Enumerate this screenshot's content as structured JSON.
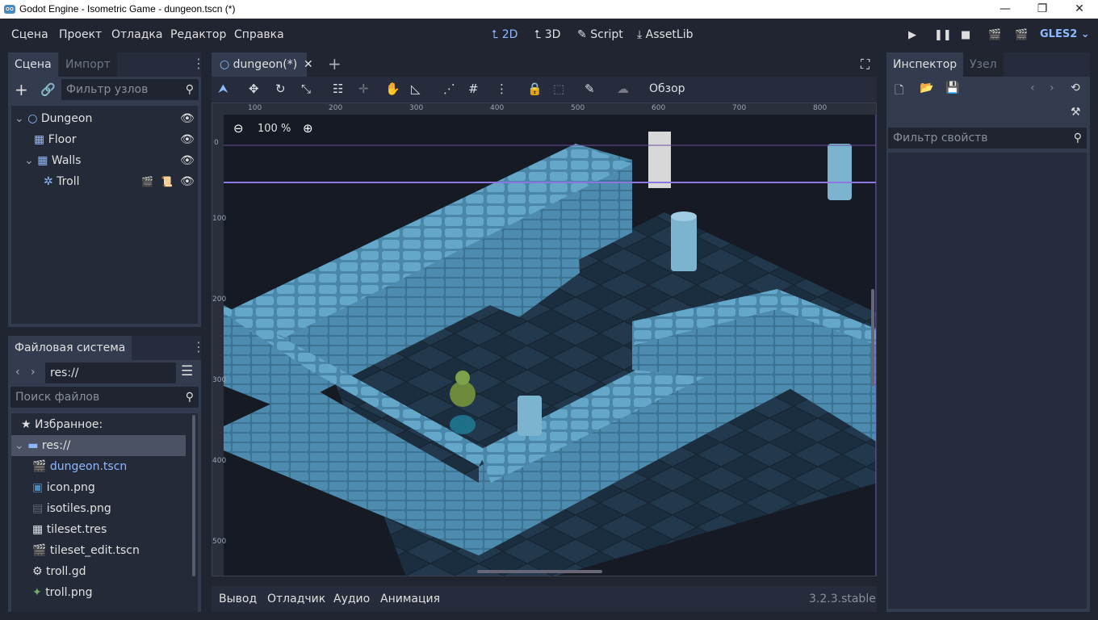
{
  "window": {
    "title": "Godot Engine - Isometric Game - dungeon.tscn (*)",
    "minimize": "—",
    "maximize": "❐",
    "close": "✕"
  },
  "menu": {
    "items": [
      "Сцена",
      "Проект",
      "Отладка",
      "Редактор",
      "Справка"
    ]
  },
  "workspaces": {
    "w2d": "2D",
    "w3d": "3D",
    "script": "Script",
    "assetlib": "AssetLib"
  },
  "renderer": "GLES2",
  "scene_dock": {
    "tab_scene": "Сцена",
    "tab_import": "Импорт",
    "filter_placeholder": "Фильтр узлов",
    "nodes": [
      {
        "label": "Dungeon"
      },
      {
        "label": "Floor"
      },
      {
        "label": "Walls"
      },
      {
        "label": "Troll"
      }
    ]
  },
  "fs_dock": {
    "tab": "Файловая система",
    "path": "res://",
    "search_placeholder": "Поиск файлов",
    "favorites": "Избранное:",
    "root": "res://",
    "files": [
      {
        "label": "dungeon.tscn",
        "highlight": true
      },
      {
        "label": "icon.png"
      },
      {
        "label": "isotiles.png"
      },
      {
        "label": "tileset.tres"
      },
      {
        "label": "tileset_edit.tscn"
      },
      {
        "label": "troll.gd"
      },
      {
        "label": "troll.png"
      }
    ]
  },
  "editor": {
    "tab_label": "dungeon(*)",
    "view_button": "Обзор",
    "zoom": "100 %",
    "ruler_h": [
      "100",
      "200",
      "300",
      "400",
      "500",
      "600",
      "700",
      "800"
    ],
    "ruler_v": [
      "0",
      "100",
      "200",
      "300",
      "400",
      "500"
    ]
  },
  "bottom": {
    "output": "Вывод",
    "debugger": "Отладчик",
    "audio": "Аудио",
    "animation": "Анимация",
    "version": "3.2.3.stable"
  },
  "inspector": {
    "tab_inspector": "Инспектор",
    "tab_node": "Узел",
    "filter_placeholder": "Фильтр свойств"
  },
  "colors": {
    "accent": "#8eb9ff",
    "wall_top": "#5a9bbd",
    "wall_side": "#3f7898",
    "floor": "#1d3347"
  }
}
